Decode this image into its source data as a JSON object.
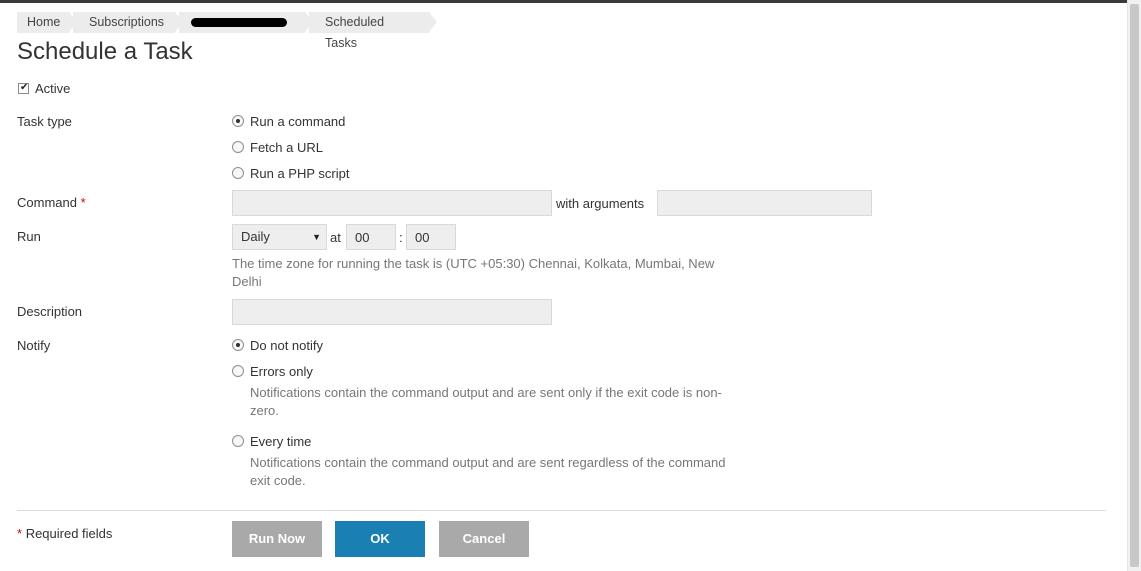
{
  "breadcrumb": [
    "Home",
    "Subscriptions",
    "",
    "Scheduled Tasks"
  ],
  "page": {
    "title": "Schedule a Task"
  },
  "active": {
    "label": "Active",
    "checked": true
  },
  "task_type": {
    "label": "Task type",
    "options": [
      "Run a command",
      "Fetch a URL",
      "Run a PHP script"
    ],
    "selected": "Run a command"
  },
  "command": {
    "label": "Command",
    "required_mark": "*",
    "value": "",
    "with_arguments_label": "with arguments",
    "arguments_value": ""
  },
  "run": {
    "label": "Run",
    "frequency": "Daily",
    "at_label": "at",
    "hour": "00",
    "separator": ":",
    "minute": "00",
    "timezone_note": "The time zone for running the task is (UTC +05:30) Chennai, Kolkata, Mumbai, New Delhi"
  },
  "description": {
    "label": "Description",
    "value": ""
  },
  "notify": {
    "label": "Notify",
    "options": [
      {
        "label": "Do not notify",
        "hint": ""
      },
      {
        "label": "Errors only",
        "hint": "Notifications contain the command output and are sent only if the exit code is non-zero."
      },
      {
        "label": "Every time",
        "hint": "Notifications contain the command output and are sent regardless of the command exit code."
      }
    ],
    "selected": "Do not notify"
  },
  "footer": {
    "required_mark": "*",
    "required_note": "Required fields",
    "buttons": {
      "run_now": "Run Now",
      "ok": "OK",
      "cancel": "Cancel"
    }
  },
  "colors": {
    "primary_button": "#1a7fb3",
    "secondary_button": "#a9a9a9",
    "required": "#d0021b"
  }
}
